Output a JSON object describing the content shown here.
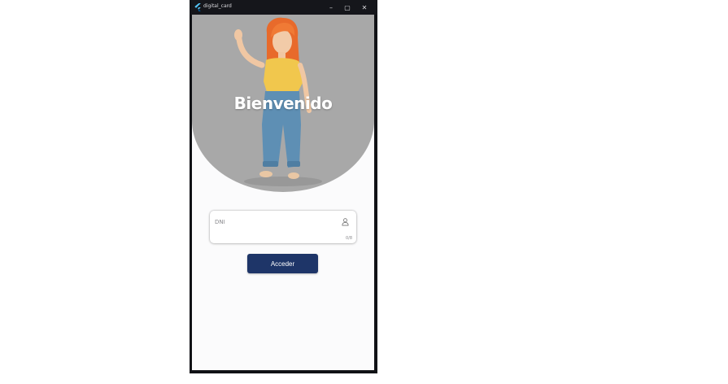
{
  "window": {
    "title": "digital_card",
    "controls": {
      "minimize": "–",
      "maximize": "▢",
      "close": "✕"
    }
  },
  "hero": {
    "heading": "Bienvenido",
    "illustration": "waving-girl-3d-character"
  },
  "form": {
    "dni_label": "DNI",
    "dni_value": "",
    "dni_counter": "0/8",
    "submit_label": "Acceder"
  },
  "colors": {
    "hero_bg": "#a8a8a8",
    "button_bg": "#1e3568",
    "titlebar_bg": "#15161b"
  }
}
